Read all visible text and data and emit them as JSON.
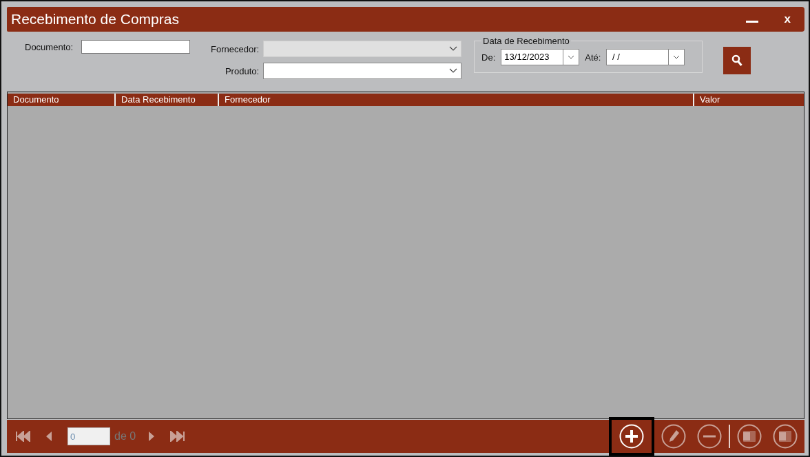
{
  "window": {
    "title": "Recebimento de Compras",
    "close_label": "x"
  },
  "filters": {
    "documento": {
      "label": "Documento:"
    },
    "fornecedor": {
      "label": "Fornecedor:",
      "disabled": true
    },
    "produto": {
      "label": "Produto:",
      "disabled": false
    }
  },
  "date_group": {
    "title": "Data de Recebimento",
    "from": {
      "label": "De:",
      "value": "13/12/2023"
    },
    "to": {
      "label": "Até:",
      "value": " / /"
    }
  },
  "table": {
    "columns": [
      "Documento",
      "Data Recebimento",
      "Fornecedor",
      "Valor"
    ]
  },
  "pager": {
    "page": "0",
    "total": "de 0",
    "disabled": true
  },
  "actions": [
    {
      "kind": "add",
      "disabled": false,
      "highlighted": true
    },
    {
      "kind": "edit",
      "disabled": true,
      "highlighted": false
    },
    {
      "kind": "delete",
      "disabled": true,
      "highlighted": false
    },
    {
      "kind": "word",
      "disabled": true,
      "highlighted": false
    },
    {
      "kind": "excel",
      "disabled": true,
      "highlighted": false
    }
  ]
}
